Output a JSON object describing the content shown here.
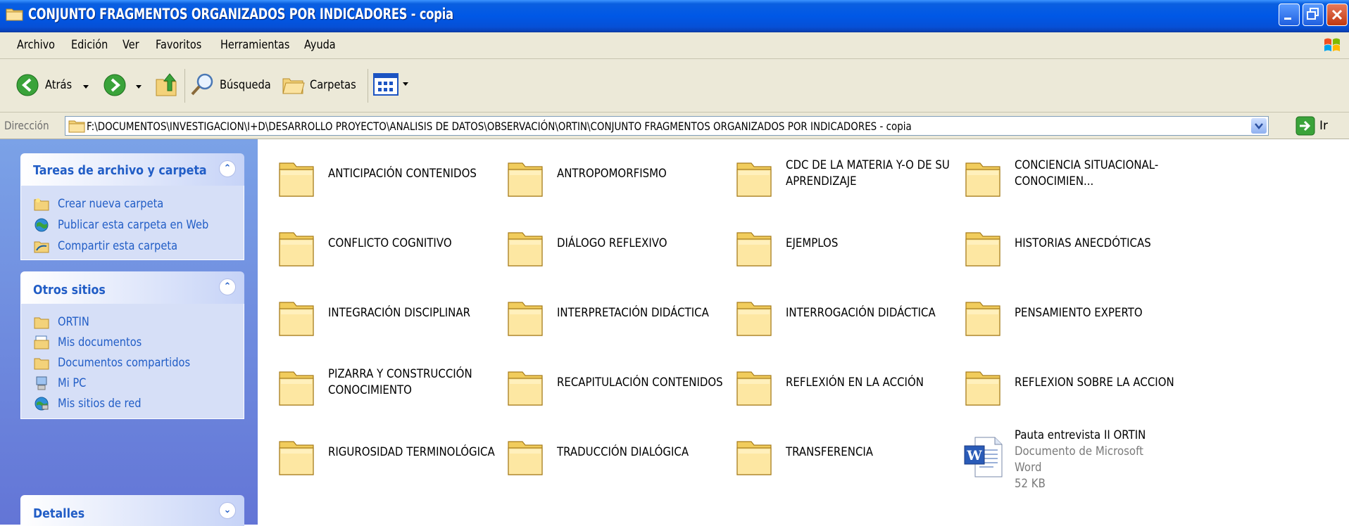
{
  "window": {
    "title": "CONJUNTO FRAGMENTOS ORGANIZADOS POR INDICADORES - copia",
    "titlebar_color": "#0058e6"
  },
  "menu": [
    "Archivo",
    "Edición",
    "Ver",
    "Favoritos",
    "Herramientas",
    "Ayuda"
  ],
  "toolbar": {
    "back_label": "Atrás",
    "search_label": "Búsqueda",
    "folders_label": "Carpetas"
  },
  "address": {
    "label": "Dirección",
    "path": "F:\\DOCUMENTOS\\INVESTIGACION\\I+D\\DESARROLLO PROYECTO\\ANALISIS DE DATOS\\OBSERVACIÓN\\ORTIN\\CONJUNTO FRAGMENTOS ORGANIZADOS POR INDICADORES - copia",
    "go_label": "Ir"
  },
  "sidebar": {
    "tasks": {
      "title": "Tareas de archivo y carpeta",
      "items": [
        {
          "label": "Crear nueva carpeta",
          "icon": "new-folder-icon"
        },
        {
          "label": "Publicar esta carpeta en Web",
          "icon": "publish-web-icon"
        },
        {
          "label": "Compartir esta carpeta",
          "icon": "share-folder-icon"
        }
      ]
    },
    "places": {
      "title": "Otros sitios",
      "items": [
        {
          "label": "ORTIN",
          "icon": "folder-icon"
        },
        {
          "label": "Mis documentos",
          "icon": "my-documents-icon"
        },
        {
          "label": "Documentos compartidos",
          "icon": "shared-documents-icon"
        },
        {
          "label": "Mi PC",
          "icon": "my-computer-icon"
        },
        {
          "label": "Mis sitios de red",
          "icon": "network-places-icon"
        }
      ]
    },
    "details": {
      "title": "Detalles"
    }
  },
  "items": [
    {
      "name": "ANTICIPACIÓN CONTENIDOS",
      "type": "folder"
    },
    {
      "name": "ANTROPOMORFISMO",
      "type": "folder"
    },
    {
      "name": "CDC DE LA MATERIA Y-O DE SU APRENDIZAJE",
      "type": "folder"
    },
    {
      "name": "CONCIENCIA SITUACIONAL-CONOCIMIEN...",
      "type": "folder"
    },
    {
      "name": "CONFLICTO COGNITIVO",
      "type": "folder"
    },
    {
      "name": "DIÁLOGO REFLEXIVO",
      "type": "folder"
    },
    {
      "name": "EJEMPLOS",
      "type": "folder"
    },
    {
      "name": "HISTORIAS ANECDÓTICAS",
      "type": "folder"
    },
    {
      "name": "INTEGRACIÓN DISCIPLINAR",
      "type": "folder"
    },
    {
      "name": "INTERPRETACIÓN DIDÁCTICA",
      "type": "folder"
    },
    {
      "name": "INTERROGACIÓN DIDÁCTICA",
      "type": "folder"
    },
    {
      "name": "PENSAMIENTO EXPERTO",
      "type": "folder"
    },
    {
      "name": "PIZARRA Y CONSTRUCCIÓN CONOCIMIENTO",
      "type": "folder"
    },
    {
      "name": "RECAPITULACIÓN CONTENIDOS",
      "type": "folder"
    },
    {
      "name": "REFLEXIÓN EN LA ACCIÓN",
      "type": "folder"
    },
    {
      "name": "REFLEXION SOBRE LA ACCION",
      "type": "folder"
    },
    {
      "name": "RIGUROSIDAD TERMINOLÓGICA",
      "type": "folder"
    },
    {
      "name": "TRADUCCIÓN DIALÓGICA",
      "type": "folder"
    },
    {
      "name": "TRANSFERENCIA",
      "type": "folder"
    },
    {
      "name": "Pauta entrevista II ORTIN",
      "type": "word-document",
      "kind": "Documento de Microsoft Word",
      "size": "52 KB"
    }
  ]
}
